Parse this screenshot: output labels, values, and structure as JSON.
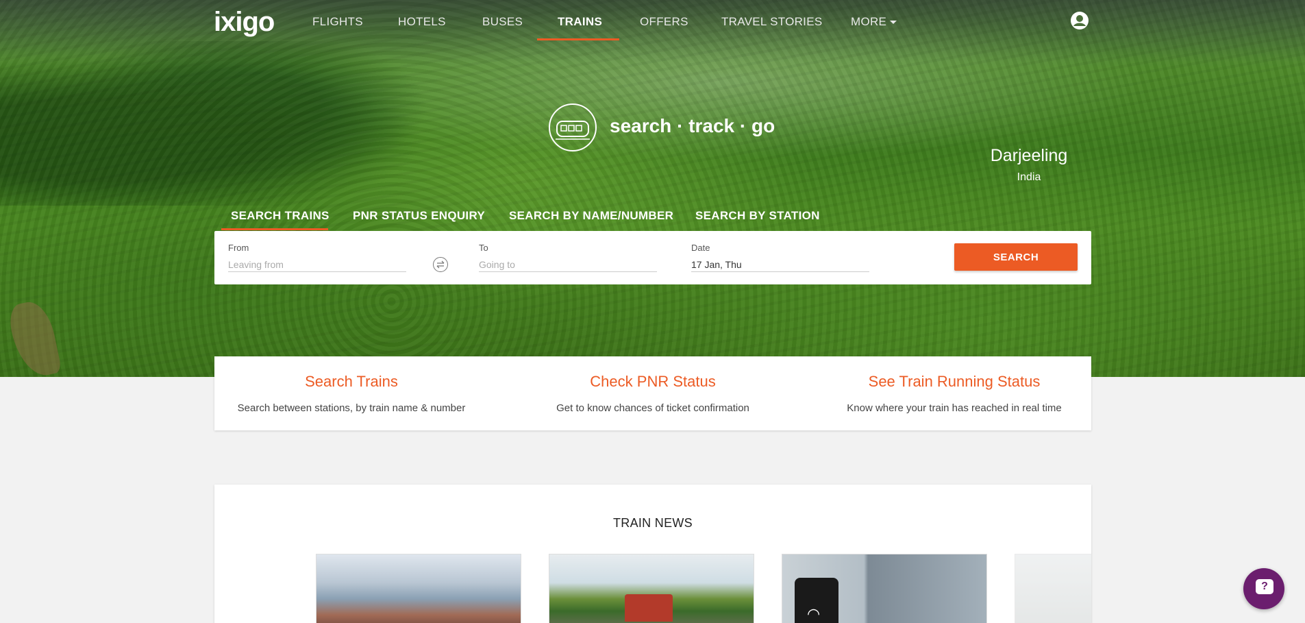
{
  "brand": {
    "logo": "ixigo"
  },
  "nav": {
    "items": [
      {
        "label": "FLIGHTS"
      },
      {
        "label": "HOTELS"
      },
      {
        "label": "BUSES"
      },
      {
        "label": "TRAINS"
      },
      {
        "label": "OFFERS"
      },
      {
        "label": "TRAVEL STORIES"
      },
      {
        "label": "MORE"
      }
    ],
    "active": "TRAINS"
  },
  "hero": {
    "tagline": "search · track · go",
    "location_city": "Darjeeling",
    "location_country": "India"
  },
  "search_tabs": [
    {
      "label": "SEARCH TRAINS"
    },
    {
      "label": "PNR STATUS ENQUIRY"
    },
    {
      "label": "SEARCH BY NAME/NUMBER"
    },
    {
      "label": "SEARCH BY STATION"
    }
  ],
  "search_form": {
    "from_label": "From",
    "from_placeholder": "Leaving from",
    "to_label": "To",
    "to_placeholder": "Going to",
    "date_label": "Date",
    "date_value": "17 Jan, Thu",
    "search_button": "SEARCH"
  },
  "features": [
    {
      "title": "Search Trains",
      "desc": "Search between stations, by train name & number"
    },
    {
      "title": "Check PNR Status",
      "desc": "Get to know chances of ticket confirmation"
    },
    {
      "title": "See Train Running Status",
      "desc": "Know where your train has reached in real time"
    }
  ],
  "news": {
    "title": "TRAIN NEWS"
  },
  "colors": {
    "accent": "#ec5b24",
    "chat": "#6b1e6e"
  },
  "icons": [
    "user-icon",
    "train-icon",
    "swap-icon",
    "chevron-down-icon",
    "chat-icon"
  ]
}
